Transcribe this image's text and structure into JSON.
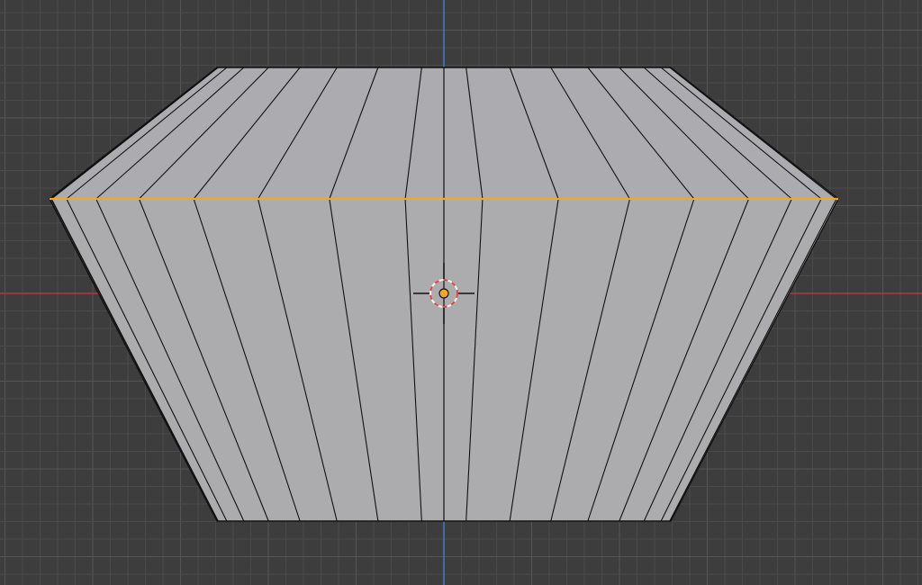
{
  "viewport": {
    "view": "front-orthographic",
    "mode": "edit-mode",
    "selection": "edge-ring-selected"
  },
  "colors": {
    "background": "#3d3d3d",
    "grid_minor": "#4a4a4a",
    "grid_major": "#555555",
    "axis_x": "#b5344a",
    "axis_z": "#3f7bd6",
    "mesh_edge": "#111111",
    "selected_edge": "#f5a623",
    "origin": "#f5a623",
    "cursor_ring_red": "#e04545",
    "cursor_ring_white": "#f2f2f2"
  },
  "mesh": {
    "object": "cylinder-like-mesh",
    "segments_visible": 16,
    "shading": "solid"
  },
  "icons": {
    "origin": "object-origin-icon",
    "cursor": "3d-cursor-icon"
  }
}
